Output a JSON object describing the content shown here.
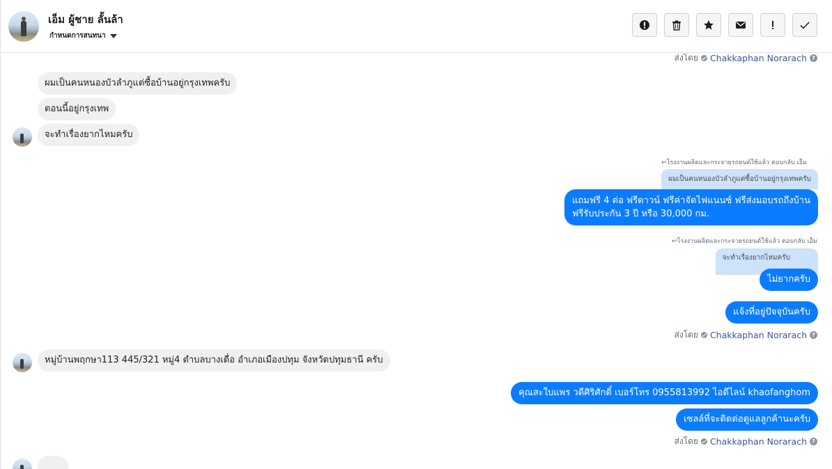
{
  "header": {
    "contact_name": "เอ็ม ผู้ชาย ลั้นล้า",
    "status_label": "กำหนดการสนทนา"
  },
  "toolbar": {
    "icons": [
      "report-icon",
      "trash-icon",
      "star-icon",
      "mail-icon",
      "exclamation-icon",
      "check-icon"
    ]
  },
  "sent_by": {
    "prefix": "ส่งโดย",
    "name": "Chakkaphan Norarach",
    "help": "?"
  },
  "messages": {
    "in_1": "ผมเป็นคนหนองบัวลำภูแต่ซื้อบ้านอยู่กรุงเทพครับ",
    "in_2": "ตอนนี้อยู่กรุงเทพ",
    "in_3": "จะทำเรื่องยากไหมครับ",
    "reply_1_meta": "↩โรงงานผลิตและกระจายรถยนต์ใช้แล้ว ตอบกลับ เอ็ม",
    "reply_1_quote": "ผมเป็นคนหนองบัวลำภูแต่ซื้อบ้านอยู่กรุงเทพครับ",
    "out_1_line1": "แถมฟรี 4 ต่อ ฟรีดาวน์ ฟรีค่าจัดไฟแนนซ์ ฟรีส่งมอบรถถึงบ้าน",
    "out_1_line2": "ฟรีรับประกัน 3 ปี หรือ 30,000 กม.",
    "reply_2_meta": "↩โรงงานผลิตและกระจายรถยนต์ใช้แล้ว ตอบกลับ เอ็ม",
    "reply_2_quote": "จะทำเรื่องยากไหมครับ",
    "out_2": "ไม่ยากครับ",
    "out_3": "แจ้งที่อยู่ปัจจุบันครับ",
    "in_4": "หมู่บ้านพฤกษา113 445/321 หมู่4 ตำบลบางเดื่อ อำเภอเมืองปทุม จังหวัดปทุมธานี ครับ",
    "out_4": "คุณสะใบแพร วดีศิริศักดิ์ เบอร์โทร 0955813992  ไอดีไลน์  khaofanghom",
    "out_5": "เซลล์ที่จะติดต่อดูแลลูกค้านะครับ"
  }
}
